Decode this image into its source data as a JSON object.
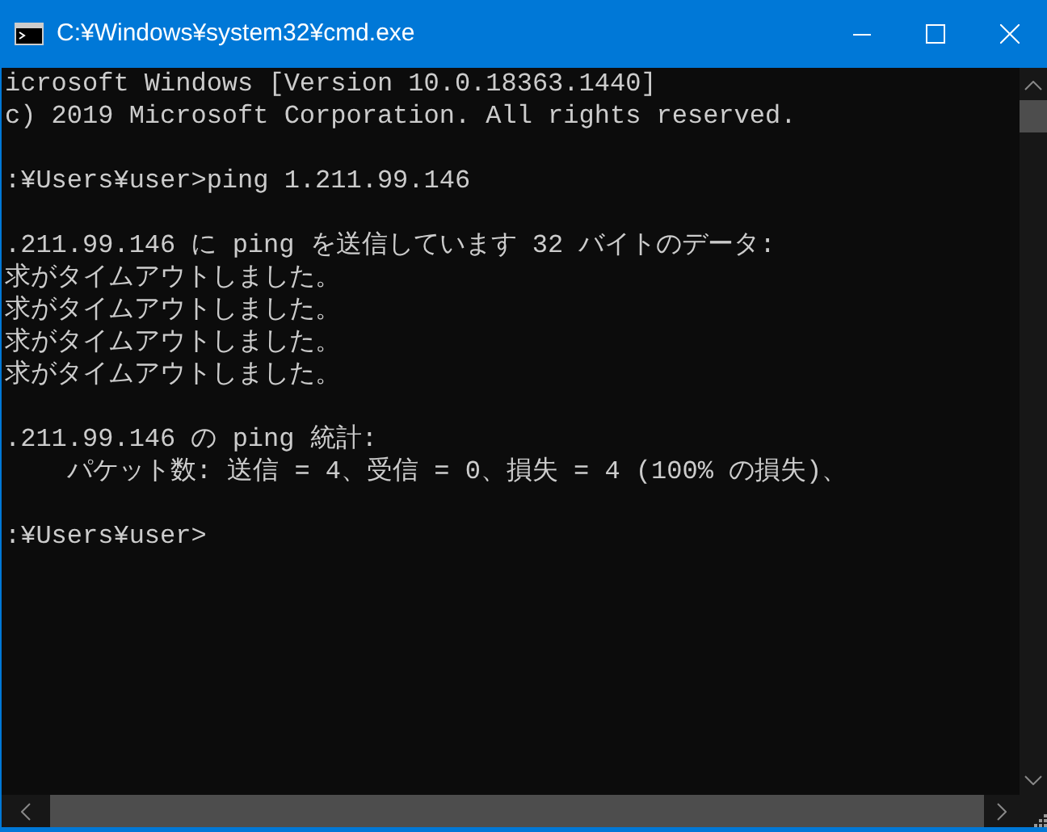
{
  "window": {
    "title": "C:¥Windows¥system32¥cmd.exe"
  },
  "console": {
    "blocks": [
      [
        "icrosoft Windows [Version 10.0.18363.1440]",
        "c) 2019 Microsoft Corporation. All rights reserved."
      ],
      [
        ":¥Users¥user>ping 1.211.99.146"
      ],
      [
        ".211.99.146 に ping を送信しています 32 バイトのデータ:",
        "求がタイムアウトしました。",
        "求がタイムアウトしました。",
        "求がタイムアウトしました。",
        "求がタイムアウトしました。"
      ],
      [
        ".211.99.146 の ping 統計:",
        "    パケット数: 送信 = 4、受信 = 0、損失 = 4 (100% の損失)、"
      ],
      [
        ":¥Users¥user>"
      ]
    ]
  }
}
